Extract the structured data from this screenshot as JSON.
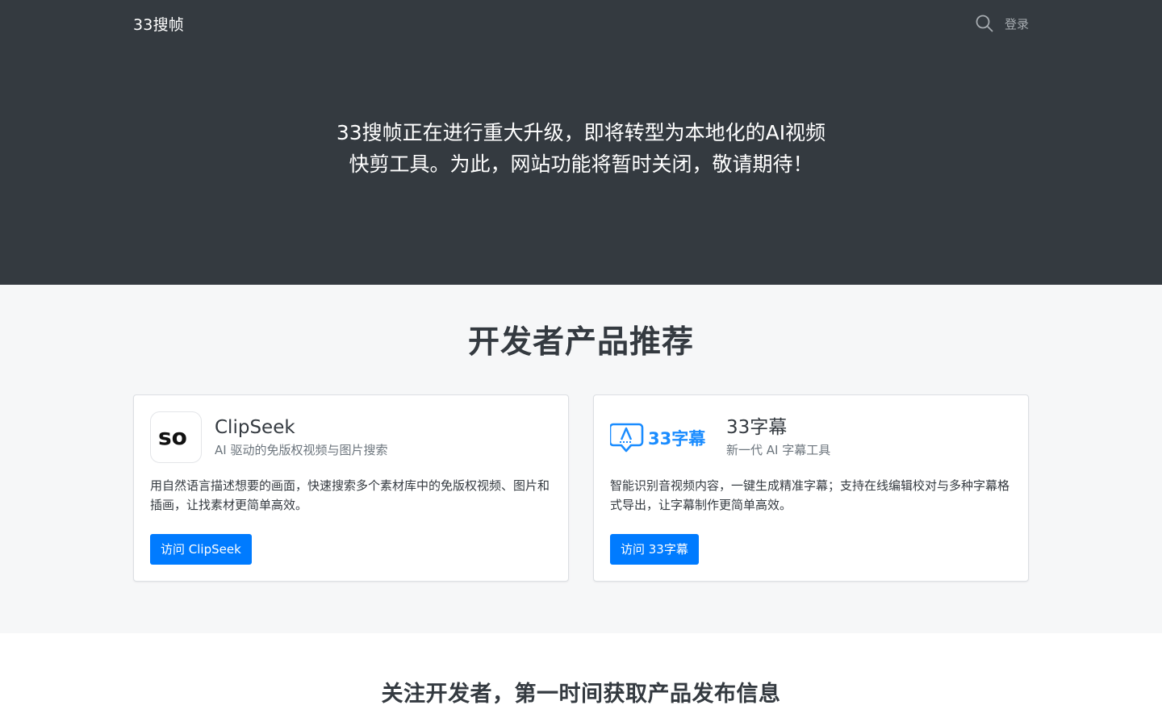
{
  "nav": {
    "brand": "33搜帧",
    "search_icon": "search-icon",
    "login": "登录"
  },
  "hero": {
    "message": "33搜帧正在进行重大升级，即将转型为本地化的AI视频快剪工具。为此，网站功能将暂时关闭，敬请期待！"
  },
  "products": {
    "heading": "开发者产品推荐",
    "items": [
      {
        "logo_icon": "clipseek-logo-icon",
        "logo_text": "so",
        "title": "ClipSeek",
        "subtitle": "AI 驱动的免版权视频与图片搜索",
        "description": "用自然语言描述想要的画面，快速搜索多个素材库中的免版权视频、图片和插画，让找素材更简单高效。",
        "button": "访问 ClipSeek"
      },
      {
        "logo_icon": "33zimu-logo-icon",
        "logo_text": "33字幕",
        "title": "33字幕",
        "subtitle": "新一代 AI 字幕工具",
        "description": "智能识别音视频内容，一键生成精准字幕；支持在线编辑校对与多种字幕格式导出，让字幕制作更简单高效。",
        "button": "访问 33字幕"
      }
    ]
  },
  "follow": {
    "heading": "关注开发者，第一时间获取产品发布信息"
  },
  "colors": {
    "header_bg": "#343a40",
    "section_bg": "#f6f7f8",
    "primary": "#007bff",
    "logo_blue": "#1a8cff"
  }
}
